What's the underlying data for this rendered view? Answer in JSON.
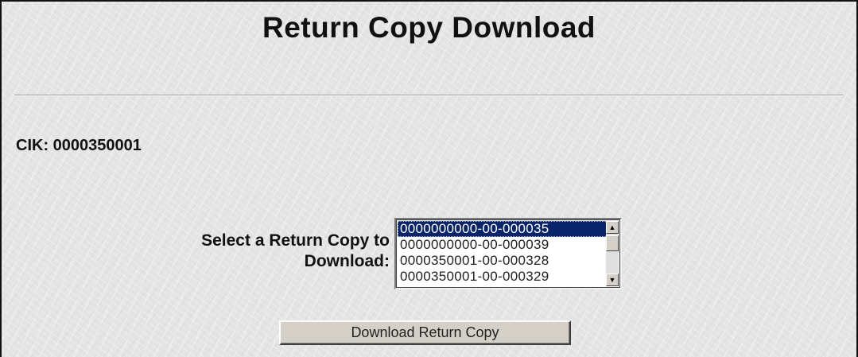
{
  "page": {
    "title": "Return Copy Download"
  },
  "cik": {
    "label": "CIK: 0000350001"
  },
  "select": {
    "label_line1": "Select a Return Copy to",
    "label_line2": "Download:",
    "options": [
      {
        "text": "0000000000-00-000035",
        "selected": true
      },
      {
        "text": "0000000000-00-000039",
        "selected": false
      },
      {
        "text": "0000350001-00-000328",
        "selected": false
      },
      {
        "text": "0000350001-00-000329",
        "selected": false
      }
    ],
    "scroll_up_icon": "▲",
    "scroll_down_icon": "▼"
  },
  "actions": {
    "download_label": "Download Return Copy"
  },
  "colors": {
    "selection_bg": "#0a246a",
    "selection_fg": "#ffffff",
    "button_face": "#d4d0c8"
  }
}
